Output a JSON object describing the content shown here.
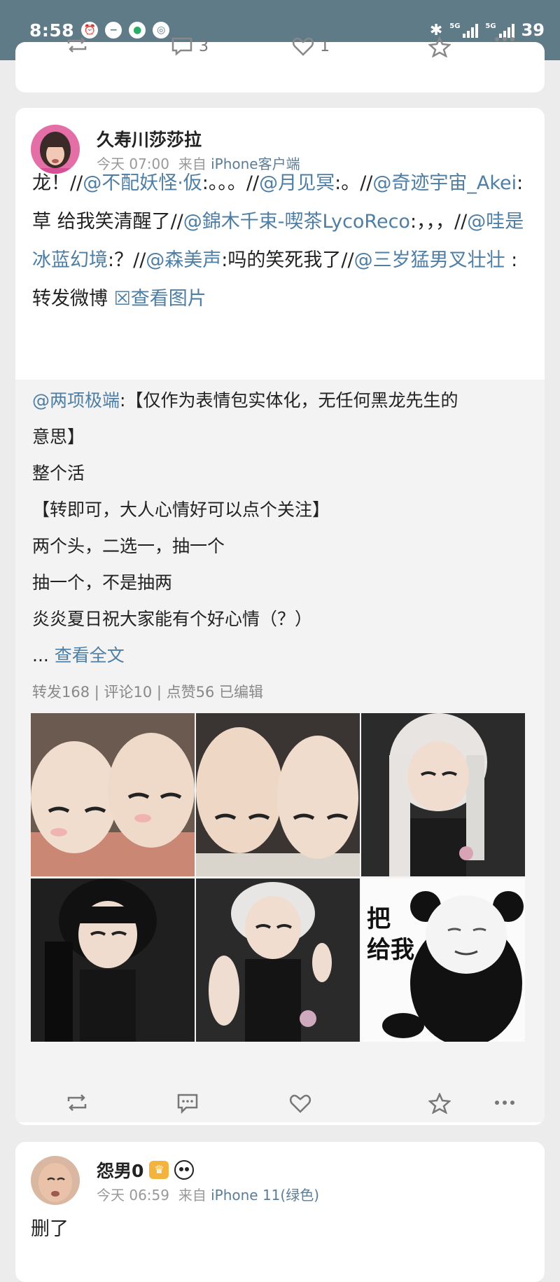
{
  "status_bar": {
    "time": "8:58",
    "network_1": "5G",
    "network_2": "5G",
    "battery": "39"
  },
  "top_card": {
    "comments": "3",
    "likes": "1"
  },
  "post": {
    "author": "久寿川莎莎拉",
    "time": "今天 07:00",
    "source_prefix": "来自",
    "source": "iPhone客户端",
    "text": {
      "p1": "龙！//",
      "m1": "@不配妖怪·仮",
      "p2": ":。。。//",
      "m2": "@月见冥",
      "p3": ":。//",
      "m3": "@奇迹宇宙_Akei",
      "p4": ":草 给我笑清醒了//",
      "m4": "@錦木千束-喫茶LycoReco",
      "p5": ":，，，//",
      "m5": "@哇是冰蓝幻境",
      "p6": ":？//",
      "m6": "@森美声",
      "p7": ":吗的笑死我了//",
      "m7": "@三岁猛男叉壮壮",
      "p8": " :转发微博 ",
      "view_images": "☒查看图片"
    },
    "quoted": {
      "author": "@两项极端",
      "line1_rest": ":【仅作为表情包实体化，无任何黑龙先生的",
      "line2": "意思】",
      "line3": "整个活",
      "line4": "【转即可，大人心情好可以点个关注】",
      "line5": "两个头，二选一，抽一个",
      "line6": "抽一个，不是抽两",
      "line7": "炎炎夏日祝大家能有个好心情（？）",
      "ellipsis": "...",
      "read_more": "查看全文",
      "counts": "转发168 | 评论10 | 点赞56   已编辑",
      "meme_text_1": "把",
      "meme_text_2": "给我"
    }
  },
  "comment": {
    "author": "怨男0",
    "time": "今天 06:59",
    "source_prefix": "来自",
    "source": "iPhone 11(绿色)",
    "text": "删了"
  },
  "colors": {
    "status_bar": "#5f7b88",
    "link": "#4e7ea3",
    "background": "#ececec"
  }
}
